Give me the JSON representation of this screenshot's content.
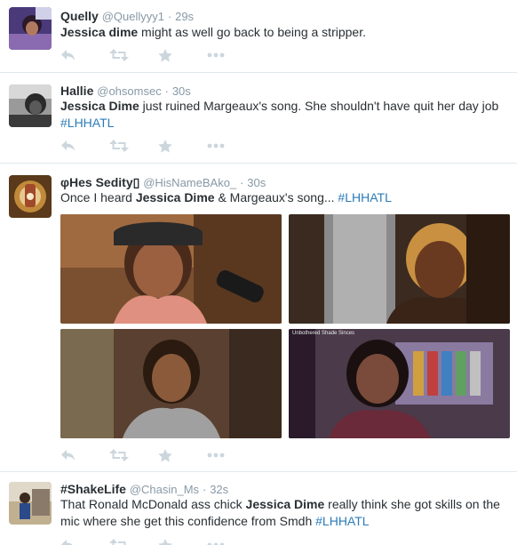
{
  "tweets": [
    {
      "name": "Quelly",
      "handle": "@Quellyyy1",
      "sep": "·",
      "time": "29s",
      "body": [
        {
          "text": "Jessica dime",
          "style": "hl"
        },
        {
          "text": " might as well go back to being a stripper.",
          "style": ""
        }
      ]
    },
    {
      "name": "Hallie",
      "handle": "@ohsomsec",
      "sep": "·",
      "time": "30s",
      "body": [
        {
          "text": "Jessica Dime",
          "style": "hl"
        },
        {
          "text": " just ruined Margeaux's song. She shouldn't have quit her day job ",
          "style": ""
        },
        {
          "text": "#LHHATL",
          "style": "tag"
        }
      ]
    },
    {
      "name": "φHes Sedity▯",
      "handle": "@HisNameBAko_",
      "sep": "·",
      "time": "30s",
      "body": [
        {
          "text": "Once I heard ",
          "style": ""
        },
        {
          "text": "Jessica Dime",
          "style": "hl"
        },
        {
          "text": " & Margeaux's song... ",
          "style": ""
        },
        {
          "text": "#LHHATL",
          "style": "tag"
        }
      ],
      "photo_watermark": "Unbothered Shade Sinces"
    },
    {
      "name": "#ShakeLife",
      "handle": "@Chasin_Ms",
      "sep": "·",
      "time": "32s",
      "body": [
        {
          "text": "That Ronald McDonald ass chick ",
          "style": ""
        },
        {
          "text": "Jessica Dime",
          "style": "hl"
        },
        {
          "text": " really think she got skills on the mic where she get this confidence from Smdh  ",
          "style": ""
        },
        {
          "text": "#LHHATL",
          "style": "tag"
        }
      ]
    }
  ],
  "icons": {
    "reply": "reply-icon",
    "retweet": "retweet-icon",
    "favorite": "star-icon",
    "more": "more-dots-icon"
  },
  "colors": {
    "text": "#292f33",
    "muted": "#8899a6",
    "link": "#2b7bb9",
    "icon": "#ccd6dd",
    "divider": "#e1e8ed"
  }
}
